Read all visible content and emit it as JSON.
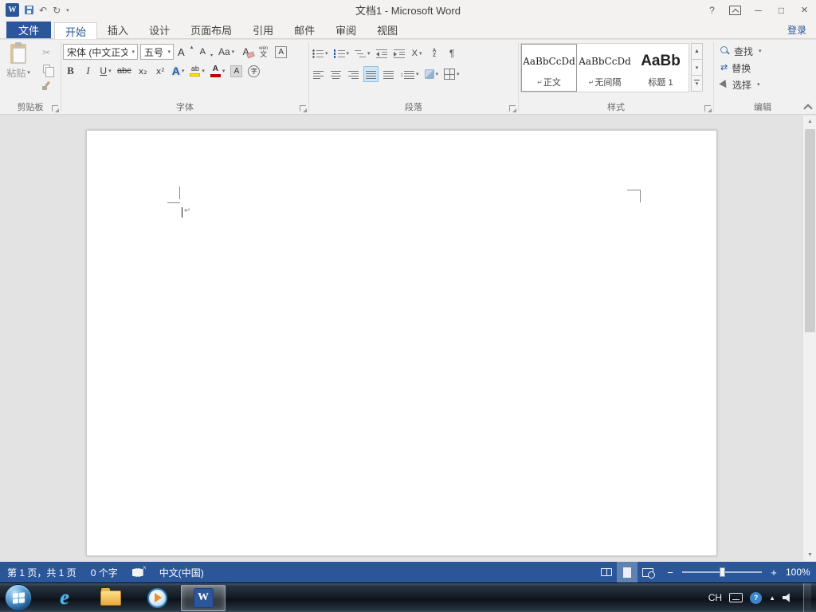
{
  "icons": {
    "dropdown": "▾",
    "undo": "↶",
    "redo": "↻",
    "cut": "✂",
    "help": "?",
    "minimize": "─",
    "maximize": "□",
    "close": "×",
    "x": "×",
    "pilcrow": "¶",
    "para_mark": "↵",
    "caret_up": "▲",
    "replace": "⇄",
    "updown": "↕",
    "minus": "−",
    "plus": "+",
    "scroll_up": "▲",
    "scroll_down": "▼"
  },
  "titlebar": {
    "title": "文档1 - Microsoft Word"
  },
  "tabs": {
    "file": "文件",
    "home": "开始",
    "insert": "插入",
    "design": "设计",
    "layout": "页面布局",
    "references": "引用",
    "mailings": "邮件",
    "review": "审阅",
    "view": "视图",
    "sign_in": "登录"
  },
  "ribbon": {
    "clipboard": {
      "label": "剪贴板",
      "paste": "粘贴"
    },
    "font": {
      "label": "字体",
      "name": "宋体 (中文正文)",
      "size": "五号",
      "grow": "A",
      "shrink": "A",
      "case": "Aa",
      "clear": "A",
      "phonetic_top": "wén",
      "phonetic_bottom": "文",
      "border": "A",
      "bold": "B",
      "italic": "I",
      "underline": "U",
      "strike": "abc",
      "subscript": "x₂",
      "superscript": "x²",
      "effects": "A",
      "highlight": "ab",
      "color": "A",
      "shading": "A",
      "enclose": "字"
    },
    "paragraph": {
      "label": "段落",
      "sort_a": "A",
      "sort_z": "Z",
      "asian": "X"
    },
    "styles": {
      "label": "样式",
      "items": [
        {
          "preview": "AaBbCcDd",
          "mark": "↵",
          "name": "正文"
        },
        {
          "preview": "AaBbCcDd",
          "mark": "↵",
          "name": "无间隔"
        },
        {
          "preview": "AaBb",
          "mark": "",
          "name": "标题 1"
        }
      ]
    },
    "editing": {
      "label": "编辑",
      "find": "查找",
      "replace": "替换",
      "select": "选择"
    }
  },
  "statusbar": {
    "page": "第 1 页，共 1 页",
    "words": "0 个字",
    "language": "中文(中国)",
    "zoom": "100%"
  },
  "taskbar": {
    "lang": "CH"
  }
}
